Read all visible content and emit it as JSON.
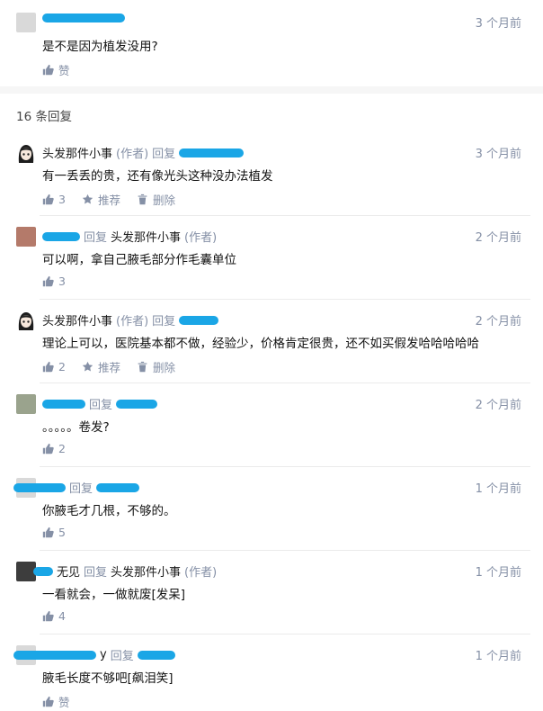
{
  "top_comment": {
    "time": "3 个月前",
    "content": "是不是因为植发没用?",
    "like_label": "赞"
  },
  "reply_count_label": "16 条回复",
  "replies": [
    {
      "author": "头发那件小事",
      "author_tag": "(作者)",
      "reply_word": "回复",
      "time": "3 个月前",
      "content": "有一丢丢的贵，还有像光头这种没办法植发",
      "likes": "3",
      "recommend_label": "推荐",
      "delete_label": "删除"
    },
    {
      "reply_word": "回复",
      "target": "头发那件小事",
      "target_tag": "(作者)",
      "time": "2 个月前",
      "content": "可以啊，拿自己腋毛部分作毛囊单位",
      "likes": "3"
    },
    {
      "author": "头发那件小事",
      "author_tag": "(作者)",
      "reply_word": "回复",
      "time": "2 个月前",
      "content": "理论上可以，医院基本都不做，经验少，价格肯定很贵，还不如买假发哈哈哈哈哈",
      "likes": "2",
      "recommend_label": "推荐",
      "delete_label": "删除"
    },
    {
      "reply_word": "回复",
      "time": "2 个月前",
      "content": "。。。。。卷发?",
      "likes": "2"
    },
    {
      "reply_word": "回复",
      "time": "1 个月前",
      "content": "你腋毛才几根，不够的。",
      "likes": "5"
    },
    {
      "author_suffix": "无见",
      "reply_word": "回复",
      "target": "头发那件小事",
      "target_tag": "(作者)",
      "time": "1 个月前",
      "content": "一看就会，一做就废[发呆]",
      "likes": "4"
    },
    {
      "author_suffix": "y",
      "reply_word": "回复",
      "time": "1 个月前",
      "content": "腋毛长度不够吧[飙泪笑]",
      "like_label": "赞"
    }
  ],
  "colors": {
    "redaction": "#1aa6e6",
    "muted": "#8590a6",
    "text": "#121212"
  },
  "icons": [
    "thumbs-up-icon",
    "star-icon",
    "trash-icon"
  ]
}
